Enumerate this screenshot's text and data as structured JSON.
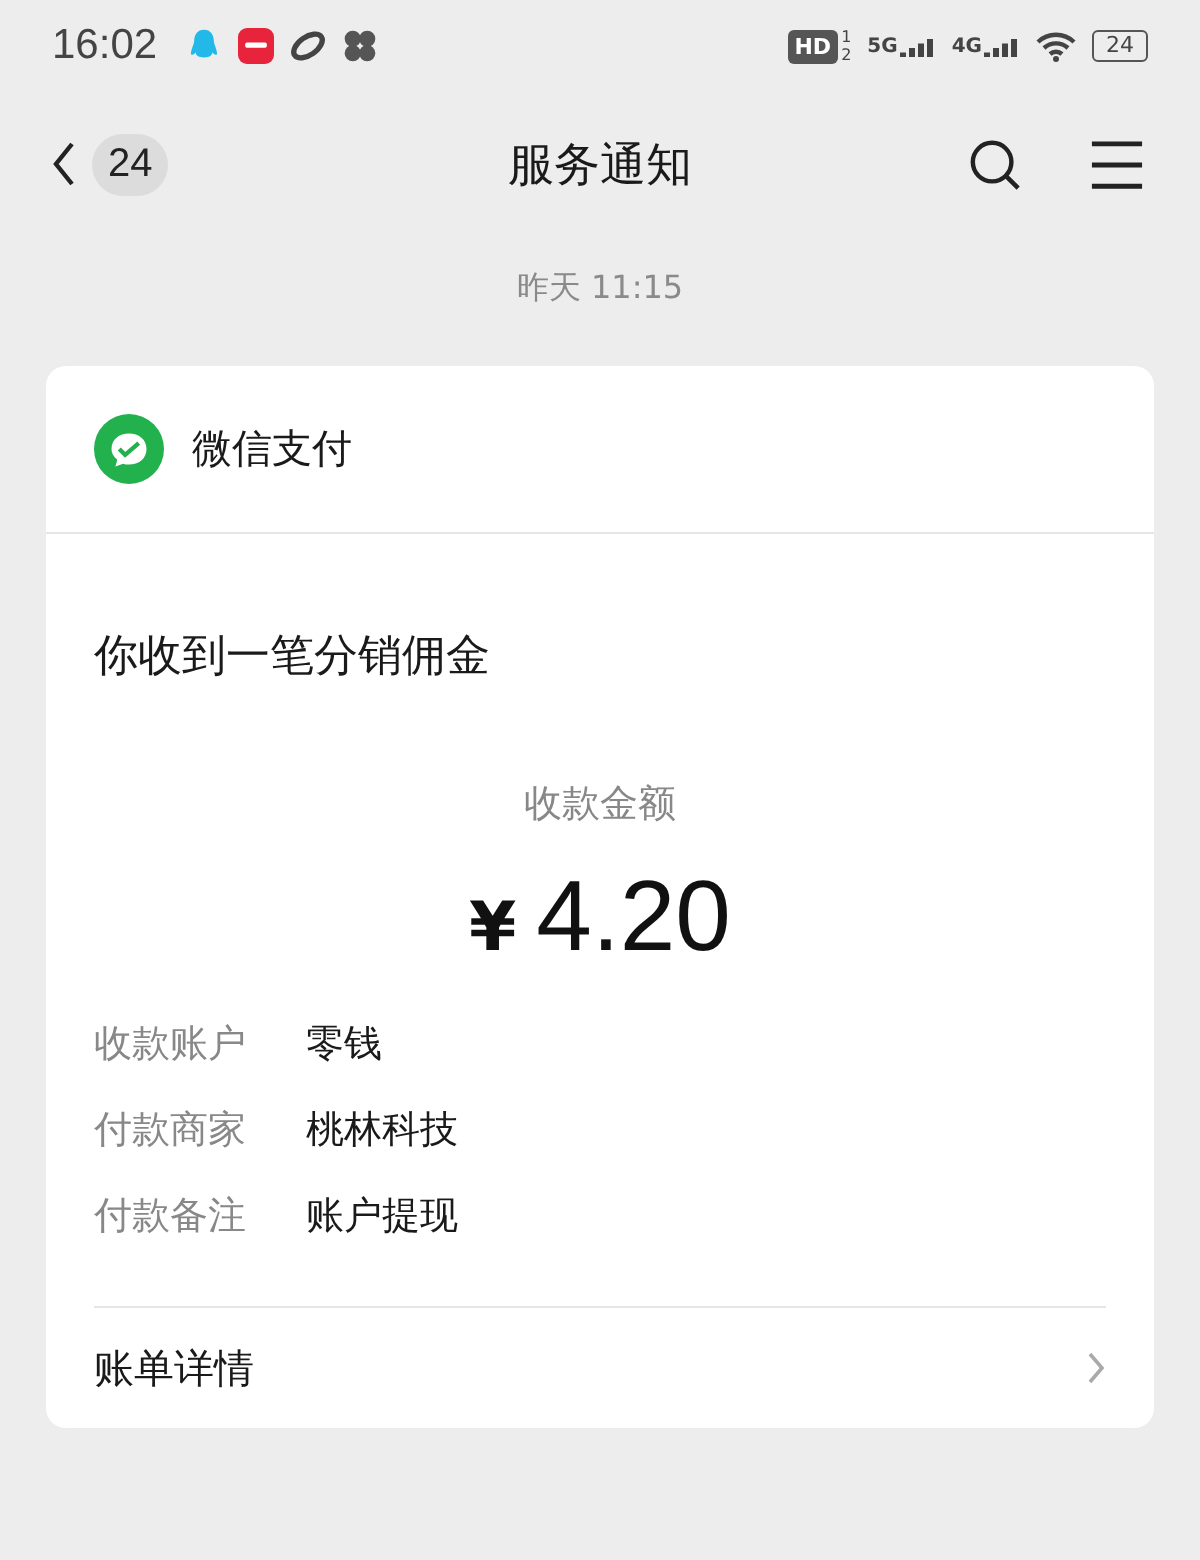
{
  "status_bar": {
    "time": "16:02",
    "hd": "HD",
    "sim_slots": [
      "1",
      "2"
    ],
    "networks": [
      {
        "label": "5G"
      },
      {
        "label": "4G"
      }
    ],
    "battery": "24"
  },
  "nav": {
    "back_count": "24",
    "title": "服务通知"
  },
  "timestamp": "昨天 11:15",
  "card": {
    "source": "微信支付",
    "headline": "你收到一笔分销佣金",
    "amount_label": "收款金额",
    "currency": "¥",
    "amount": "4.20",
    "details": [
      {
        "label": "收款账户",
        "value": "零钱"
      },
      {
        "label": "付款商家",
        "value": "桃林科技"
      },
      {
        "label": "付款备注",
        "value": "账户提现"
      }
    ],
    "footer_link": "账单详情"
  }
}
